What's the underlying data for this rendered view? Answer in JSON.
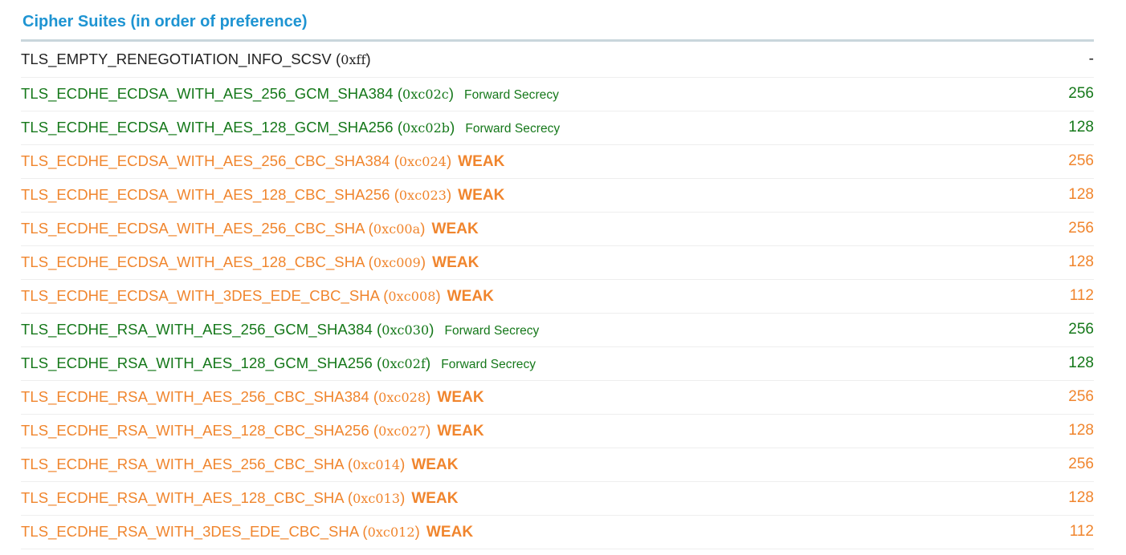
{
  "section": {
    "title": "Cipher Suites (in order of preference)"
  },
  "colors": {
    "title": "#1e94d2",
    "plain": "#222222",
    "forward_secrecy": "#15781a",
    "weak": "#f0852d",
    "divider": "#c9d6dc"
  },
  "suites": [
    {
      "name": "TLS_EMPTY_RENEGOTIATION_INFO_SCSV",
      "code": "0xff",
      "note": "",
      "bits": "-",
      "status": "plain"
    },
    {
      "name": "TLS_ECDHE_ECDSA_WITH_AES_256_GCM_SHA384",
      "code": "0xc02c",
      "note": "Forward Secrecy",
      "bits": "256",
      "status": "good"
    },
    {
      "name": "TLS_ECDHE_ECDSA_WITH_AES_128_GCM_SHA256",
      "code": "0xc02b",
      "note": "Forward Secrecy",
      "bits": "128",
      "status": "good"
    },
    {
      "name": "TLS_ECDHE_ECDSA_WITH_AES_256_CBC_SHA384",
      "code": "0xc024",
      "note": "WEAK",
      "bits": "256",
      "status": "weak"
    },
    {
      "name": "TLS_ECDHE_ECDSA_WITH_AES_128_CBC_SHA256",
      "code": "0xc023",
      "note": "WEAK",
      "bits": "128",
      "status": "weak"
    },
    {
      "name": "TLS_ECDHE_ECDSA_WITH_AES_256_CBC_SHA",
      "code": "0xc00a",
      "note": "WEAK",
      "bits": "256",
      "status": "weak"
    },
    {
      "name": "TLS_ECDHE_ECDSA_WITH_AES_128_CBC_SHA",
      "code": "0xc009",
      "note": "WEAK",
      "bits": "128",
      "status": "weak"
    },
    {
      "name": "TLS_ECDHE_ECDSA_WITH_3DES_EDE_CBC_SHA",
      "code": "0xc008",
      "note": "WEAK",
      "bits": "112",
      "status": "weak"
    },
    {
      "name": "TLS_ECDHE_RSA_WITH_AES_256_GCM_SHA384",
      "code": "0xc030",
      "note": "Forward Secrecy",
      "bits": "256",
      "status": "good"
    },
    {
      "name": "TLS_ECDHE_RSA_WITH_AES_128_GCM_SHA256",
      "code": "0xc02f",
      "note": "Forward Secrecy",
      "bits": "128",
      "status": "good"
    },
    {
      "name": "TLS_ECDHE_RSA_WITH_AES_256_CBC_SHA384",
      "code": "0xc028",
      "note": "WEAK",
      "bits": "256",
      "status": "weak"
    },
    {
      "name": "TLS_ECDHE_RSA_WITH_AES_128_CBC_SHA256",
      "code": "0xc027",
      "note": "WEAK",
      "bits": "128",
      "status": "weak"
    },
    {
      "name": "TLS_ECDHE_RSA_WITH_AES_256_CBC_SHA",
      "code": "0xc014",
      "note": "WEAK",
      "bits": "256",
      "status": "weak"
    },
    {
      "name": "TLS_ECDHE_RSA_WITH_AES_128_CBC_SHA",
      "code": "0xc013",
      "note": "WEAK",
      "bits": "128",
      "status": "weak"
    },
    {
      "name": "TLS_ECDHE_RSA_WITH_3DES_EDE_CBC_SHA",
      "code": "0xc012",
      "note": "WEAK",
      "bits": "112",
      "status": "weak"
    }
  ]
}
